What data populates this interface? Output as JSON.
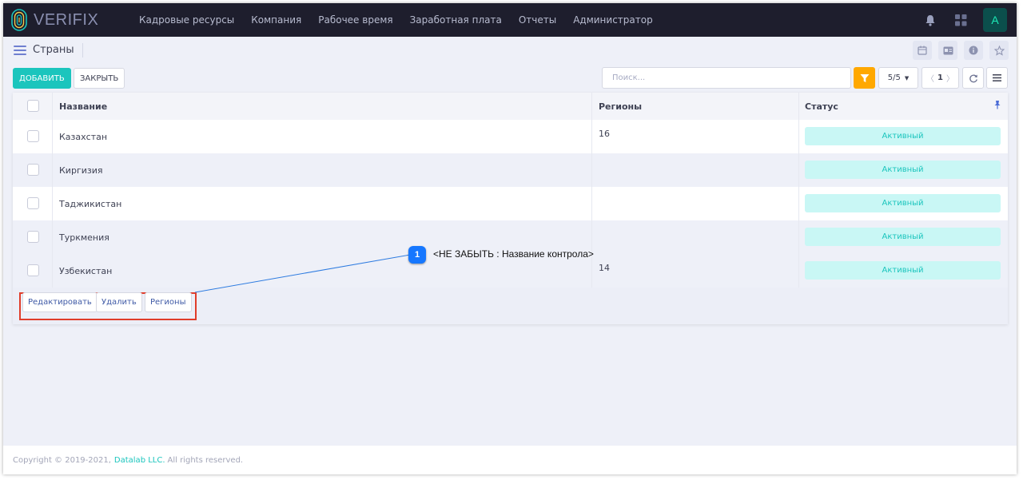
{
  "header": {
    "brand": "VERIFIX",
    "menu": [
      "Кадровые ресурсы",
      "Компания",
      "Рабочее время",
      "Заработная плата",
      "Отчеты",
      "Администратор"
    ],
    "avatar_letter": "A"
  },
  "page": {
    "title": "Страны"
  },
  "toolbar": {
    "add_label": "ДОБАВИТЬ",
    "close_label": "ЗАКРЫТЬ",
    "search_placeholder": "Поиск...",
    "page_size": "5/5",
    "page_number": "1"
  },
  "table": {
    "columns": [
      "Название",
      "Регионы",
      "Статус"
    ],
    "rows": [
      {
        "name": "Казахстан",
        "regions": "16",
        "status": "Активный"
      },
      {
        "name": "Киргизия",
        "regions": "",
        "status": "Активный"
      },
      {
        "name": "Таджикистан",
        "regions": "",
        "status": "Активный"
      },
      {
        "name": "Туркмения",
        "regions": "",
        "status": "Активный"
      },
      {
        "name": "Узбекистан",
        "regions": "14",
        "status": "Активный"
      }
    ]
  },
  "actions": {
    "edit_label": "Редактировать",
    "delete_label": "Удалить",
    "regions_label": "Регионы"
  },
  "annotation": {
    "number": "1",
    "text": "<НЕ ЗАБЫТЬ : Название контрола>"
  },
  "footer": {
    "copyright": "Copyright © 2019-2021,",
    "company": "Datalab LLC.",
    "rights": "All rights reserved."
  },
  "colors": {
    "accent": "#1bc5bd",
    "topbar": "#1e1e2d",
    "filter": "#ffa800",
    "status_bg": "#c9f7f5",
    "highlight": "#e03d2a",
    "annotation": "#1677ff"
  }
}
